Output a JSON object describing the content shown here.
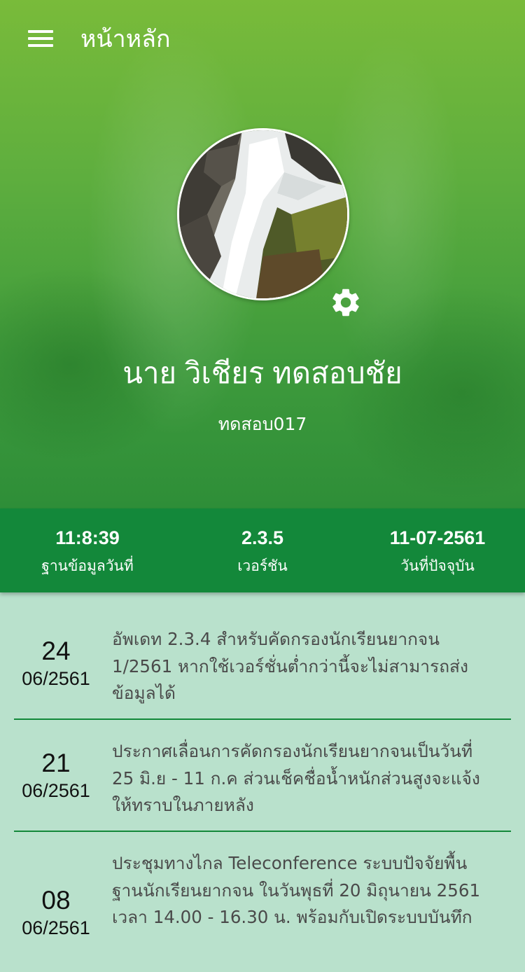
{
  "header": {
    "title": "หน้าหลัก"
  },
  "profile": {
    "name": "นาย วิเชียร ทดสอบชัย",
    "user_id": "ทดสอบ017"
  },
  "stats": [
    {
      "value": "11:8:39",
      "label": "ฐานข้อมูลวันที่"
    },
    {
      "value": "2.3.5",
      "label": "เวอร์ชัน"
    },
    {
      "value": "11-07-2561",
      "label": "วันที่ปัจจุบัน"
    }
  ],
  "news": [
    {
      "day": "24",
      "month_year": "06/2561",
      "lines": [
        "อัพเดท 2.3.4 สำหรับคัดกรองนักเรียนยากจน",
        "1/2561 หากใช้เวอร์ชั่นต่ำกว่านี้จะไม่สามารถส่ง",
        "ข้อมูลได้"
      ]
    },
    {
      "day": "21",
      "month_year": "06/2561",
      "lines": [
        "ประกาศเลื่อนการคัดกรองนักเรียนยากจนเป็นวันที่",
        "25 มิ.ย - 11 ก.ค ส่วนเช็คชื่อน้ำหนักส่วนสูงจะแจ้ง",
        "ให้ทราบในภายหลัง"
      ]
    },
    {
      "day": "08",
      "month_year": "06/2561",
      "lines": [
        "ประชุมทางไกล Teleconference ระบบปัจจัยพื้น",
        "ฐานนักเรียนยากจน ในวันพุธที่ 20 มิถุนายน 2561",
        "เวลา 14.00 - 16.30 น. พร้อมกับเปิดระบบบันทึก"
      ]
    }
  ],
  "icons": {
    "menu": "menu-icon",
    "settings": "gear-icon",
    "avatar": "waterfall-photo"
  },
  "colors": {
    "hero_top": "#79bb3a",
    "stats_bar": "#13883a",
    "list_bg": "#b9e1cc",
    "divider": "#13883a"
  }
}
